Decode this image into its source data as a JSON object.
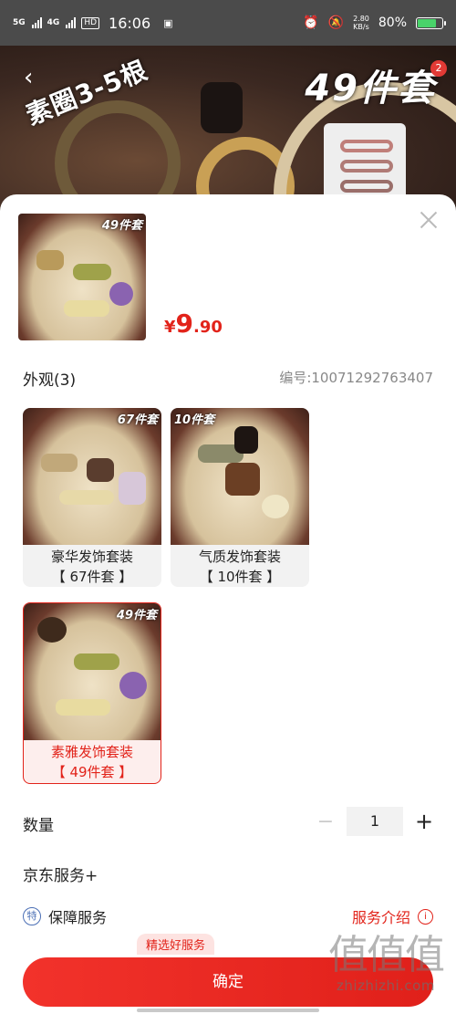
{
  "status_bar": {
    "net1": "5G",
    "net2": "4G",
    "hd": "HD",
    "time": "16:06",
    "speed_value": "2.80",
    "speed_unit": "KB/s",
    "battery": "80%",
    "battery_level": 0.8
  },
  "background": {
    "label_left": "素圈3-5根",
    "label_right": "49件套",
    "cart_badge": "2"
  },
  "sheet": {
    "main_thumb_tag": "49件套",
    "price": {
      "currency": "¥",
      "integer": "9",
      "decimal": ".90"
    },
    "appearance_title": "外观(3)",
    "code": "编号:10071292763407",
    "options": [
      {
        "tag": "67件套",
        "name": "豪华发饰套装",
        "sub": "【 67件套 】"
      },
      {
        "tag": "10件套",
        "name": "气质发饰套装",
        "sub": "【 10件套 】"
      },
      {
        "tag": "49件套",
        "name": "素雅发饰套装",
        "sub": "【 49件套 】"
      }
    ],
    "quantity_label": "数量",
    "quantity_minus": "−",
    "quantity_value": "1",
    "quantity_plus": "+",
    "service_title": "京东服务+",
    "guarantee_icon": "特",
    "guarantee_label": "保障服务",
    "service_intro": "服务介绍",
    "info_icon": "i",
    "good_service_tag": "精选好服务",
    "confirm_label": "确定"
  },
  "watermark": {
    "chars": "值值值",
    "url": "zhizhizhi.com"
  },
  "colors": {
    "accent": "#e2231a",
    "status_bar": "#4b4b4b",
    "battery": "#49d36a"
  }
}
